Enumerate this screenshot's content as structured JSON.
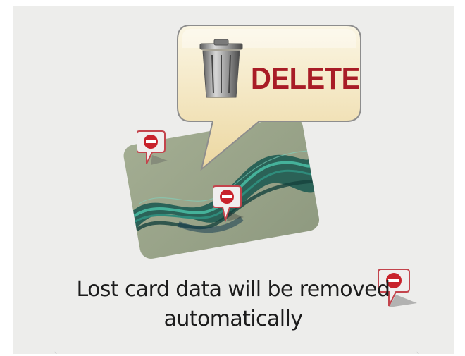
{
  "bubble": {
    "label": "DELETE",
    "icon": "trash-can-icon",
    "label_color": "#a81c26"
  },
  "card": {
    "icon": "credit-card-icon",
    "color": "#9aa68a"
  },
  "markers": [
    {
      "icon": "remove-marker-icon"
    },
    {
      "icon": "remove-marker-icon"
    },
    {
      "icon": "remove-marker-icon"
    }
  ],
  "caption": {
    "line1": "Lost card data will be removed",
    "line2": "automatically"
  }
}
